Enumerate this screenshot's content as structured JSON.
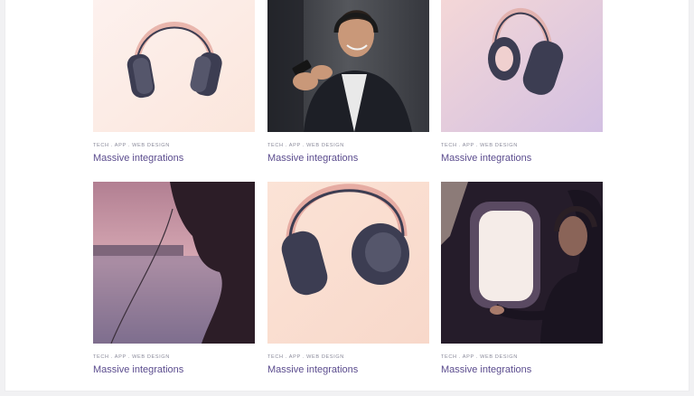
{
  "portfolio": {
    "items": [
      {
        "image": "headphones-product-shot",
        "category": "TECH . APP . WEB DESIGN",
        "title": "Massive integrations"
      },
      {
        "image": "man-with-headphones-and-phone",
        "category": "TECH . APP . WEB DESIGN",
        "title": "Massive integrations"
      },
      {
        "image": "headphones-side-view",
        "category": "TECH . APP . WEB DESIGN",
        "title": "Massive integrations"
      },
      {
        "image": "woman-silhouette-sunset",
        "category": "TECH . APP . WEB DESIGN",
        "title": "Massive integrations"
      },
      {
        "image": "headphones-closeup",
        "category": "TECH . APP . WEB DESIGN",
        "title": "Massive integrations"
      },
      {
        "image": "woman-airplane-window",
        "category": "TECH . APP . WEB DESIGN",
        "title": "Massive integrations"
      }
    ]
  },
  "colors": {
    "title": "#5b4c8e",
    "meta": "#8a8a9a"
  }
}
